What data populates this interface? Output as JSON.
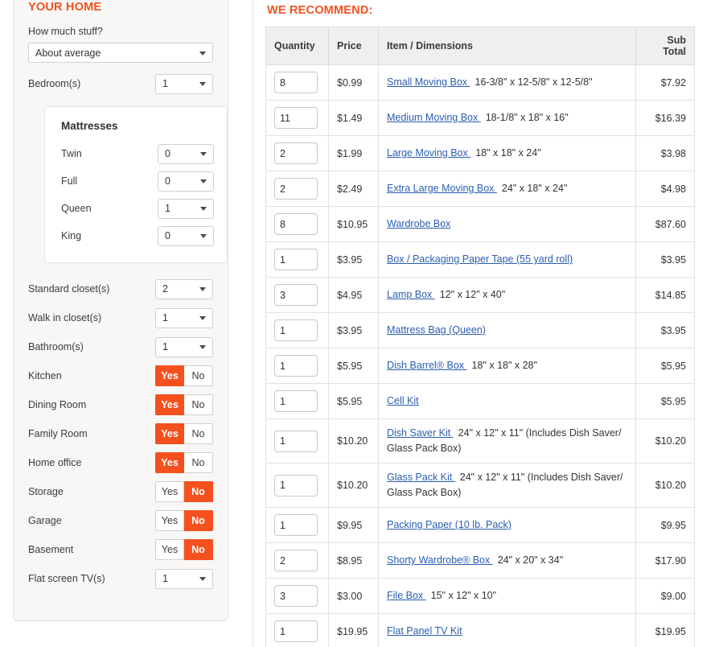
{
  "colors": {
    "accent": "#f4511e",
    "link": "#2a5db0",
    "panel_bg": "#f8f7f5",
    "header_bg": "#efefef"
  },
  "sidebar": {
    "title": "YOUR HOME",
    "stuff_label": "How much stuff?",
    "stuff_value": "About average",
    "bedrooms_label": "Bedroom(s)",
    "bedrooms_value": "1",
    "mattresses": {
      "title": "Mattresses",
      "rows": [
        {
          "label": "Twin",
          "value": "0"
        },
        {
          "label": "Full",
          "value": "0"
        },
        {
          "label": "Queen",
          "value": "1"
        },
        {
          "label": "King",
          "value": "0"
        }
      ]
    },
    "counters": [
      {
        "label": "Standard closet(s)",
        "value": "2"
      },
      {
        "label": "Walk in closet(s)",
        "value": "1"
      },
      {
        "label": "Bathroom(s)",
        "value": "1"
      }
    ],
    "toggle_yes": "Yes",
    "toggle_no": "No",
    "toggles": [
      {
        "label": "Kitchen",
        "value": "Yes"
      },
      {
        "label": "Dining Room",
        "value": "Yes"
      },
      {
        "label": "Family Room",
        "value": "Yes"
      },
      {
        "label": "Home office",
        "value": "Yes"
      },
      {
        "label": "Storage",
        "value": "No"
      },
      {
        "label": "Garage",
        "value": "No"
      },
      {
        "label": "Basement",
        "value": "No"
      }
    ],
    "tv_label": "Flat screen TV(s)",
    "tv_value": "1"
  },
  "recommend": {
    "title": "WE RECOMMEND:",
    "columns": {
      "quantity": "Quantity",
      "price": "Price",
      "item": "Item / Dimensions",
      "subtotal": "Sub Total"
    },
    "rows": [
      {
        "qty": "8",
        "price": "$0.99",
        "name": "Small Moving Box ",
        "dims": "16-3/8\" x 12-5/8\" x 12-5/8\"",
        "subtotal": "$7.92"
      },
      {
        "qty": "11",
        "price": "$1.49",
        "name": "Medium Moving Box ",
        "dims": "18-1/8\" x 18\" x 16\"",
        "subtotal": "$16.39"
      },
      {
        "qty": "2",
        "price": "$1.99",
        "name": "Large Moving Box ",
        "dims": "18\" x 18\" x 24\"",
        "subtotal": "$3.98"
      },
      {
        "qty": "2",
        "price": "$2.49",
        "name": "Extra Large Moving Box ",
        "dims": "24\" x 18\" x 24\"",
        "subtotal": "$4.98"
      },
      {
        "qty": "8",
        "price": "$10.95",
        "name": "Wardrobe Box ",
        "dims": "",
        "subtotal": "$87.60"
      },
      {
        "qty": "1",
        "price": "$3.95",
        "name": "Box / Packaging Paper Tape (55 yard roll) ",
        "dims": "",
        "subtotal": "$3.95"
      },
      {
        "qty": "3",
        "price": "$4.95",
        "name": "Lamp Box ",
        "dims": "12\" x 12\" x 40\"",
        "subtotal": "$14.85"
      },
      {
        "qty": "1",
        "price": "$3.95",
        "name": "Mattress Bag (Queen) ",
        "dims": "",
        "subtotal": "$3.95"
      },
      {
        "qty": "1",
        "price": "$5.95",
        "name": "Dish Barrel® Box ",
        "dims": "18\" x 18\" x 28\"",
        "subtotal": "$5.95"
      },
      {
        "qty": "1",
        "price": "$5.95",
        "name": "Cell Kit ",
        "dims": "",
        "subtotal": "$5.95"
      },
      {
        "qty": "1",
        "price": "$10.20",
        "name": "Dish Saver Kit ",
        "dims": "24\" x 12\" x 11\" (Includes Dish Saver/ Glass Pack Box)",
        "subtotal": "$10.20"
      },
      {
        "qty": "1",
        "price": "$10.20",
        "name": "Glass Pack Kit ",
        "dims": "24\" x 12\" x 11\" (Includes Dish Saver/ Glass Pack Box)",
        "subtotal": "$10.20"
      },
      {
        "qty": "1",
        "price": "$9.95",
        "name": "Packing Paper (10 lb. Pack) ",
        "dims": "",
        "subtotal": "$9.95"
      },
      {
        "qty": "2",
        "price": "$8.95",
        "name": "Shorty Wardrobe® Box ",
        "dims": "24\" x 20\" x 34\"",
        "subtotal": "$17.90"
      },
      {
        "qty": "3",
        "price": "$3.00",
        "name": "File Box ",
        "dims": "15\" x 12\" x 10\"",
        "subtotal": "$9.00"
      },
      {
        "qty": "1",
        "price": "$19.95",
        "name": "Flat Panel TV Kit ",
        "dims": "",
        "subtotal": "$19.95"
      }
    ]
  }
}
